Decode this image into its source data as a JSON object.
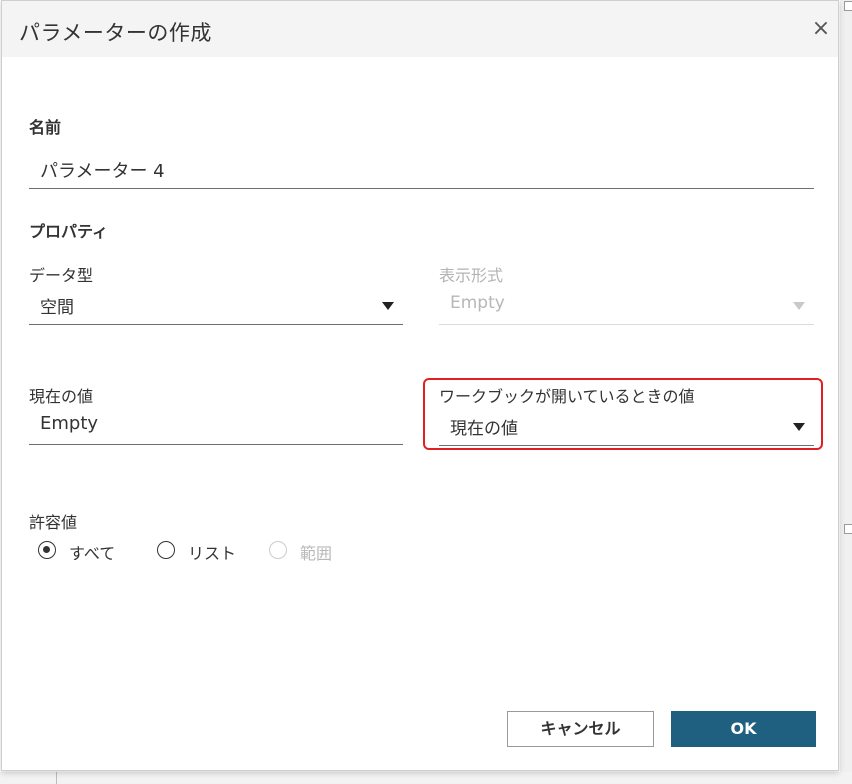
{
  "dialog": {
    "title": "パラメーターの作成",
    "close_icon": "×"
  },
  "name_section": {
    "label": "名前",
    "value": "パラメーター 4"
  },
  "properties": {
    "label": "プロパティ",
    "data_type": {
      "label": "データ型",
      "value": "空間"
    },
    "display_format": {
      "label": "表示形式",
      "value": "Empty",
      "disabled": true
    }
  },
  "current_value": {
    "label": "現在の値",
    "value": "Empty"
  },
  "workbook_open_value": {
    "label": "ワークブックが開いているときの値",
    "value": "現在の値",
    "highlight_color": "#e02020"
  },
  "allowed_values": {
    "label": "許容値",
    "options": [
      {
        "label": "すべて",
        "selected": true,
        "disabled": false
      },
      {
        "label": "リスト",
        "selected": false,
        "disabled": false
      },
      {
        "label": "範囲",
        "selected": false,
        "disabled": true
      }
    ]
  },
  "buttons": {
    "cancel": "キャンセル",
    "ok": "OK"
  },
  "colors": {
    "accent": "#1f5f7f",
    "title_bar": "#f4f4f4"
  }
}
